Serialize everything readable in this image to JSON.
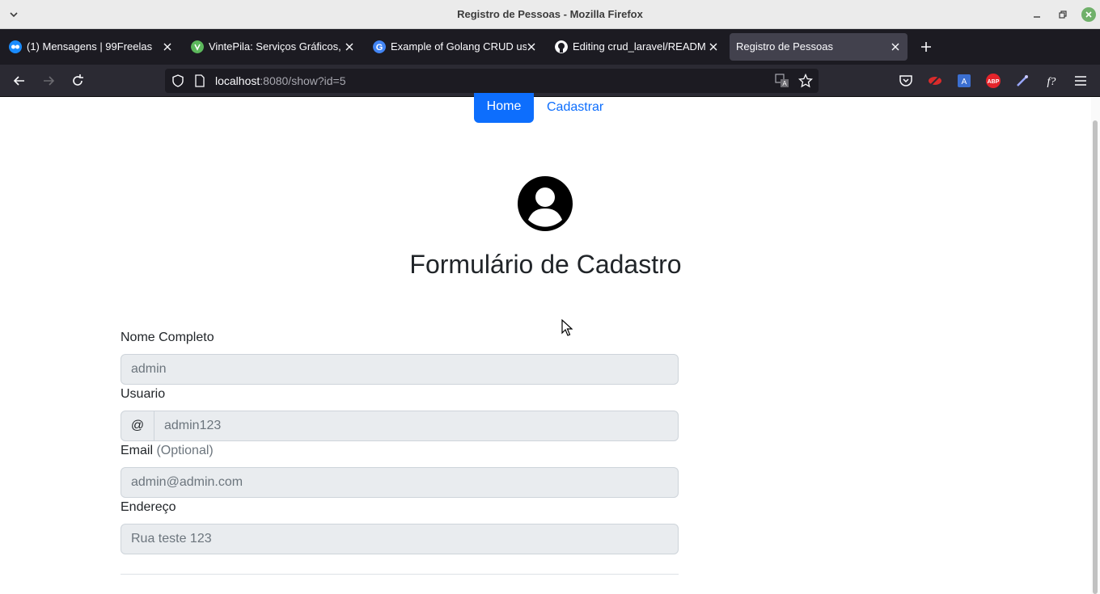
{
  "window": {
    "title": "Registro de Pessoas - Mozilla Firefox"
  },
  "tabs": [
    {
      "label": "(1) Mensagens | 99Freelas",
      "icon": "99freelas-icon",
      "active": false
    },
    {
      "label": "VintePila: Serviços Gráficos, ",
      "icon": "vintepila-icon",
      "active": false
    },
    {
      "label": "Example of Golang CRUD us",
      "icon": "google-icon",
      "active": false
    },
    {
      "label": "Editing crud_laravel/READM",
      "icon": "github-icon",
      "active": false
    },
    {
      "label": "Registro de Pessoas",
      "icon": "",
      "active": true
    }
  ],
  "urlbar": {
    "host": "localhost",
    "path": ":8080/show?id=5"
  },
  "nav": {
    "home": "Home",
    "register": "Cadastrar"
  },
  "form": {
    "heading": "Formulário de Cadastro",
    "name_label": "Nome Completo",
    "name_value": "admin",
    "user_label": "Usuario",
    "user_prefix": "@",
    "user_value": "admin123",
    "email_label": "Email",
    "email_optional": "(Optional)",
    "email_value": "admin@admin.com",
    "address_label": "Endereço",
    "address_value": "Rua teste 123"
  },
  "colors": {
    "primary": "#0d6efd",
    "tabbar": "#1c1b22",
    "toolbar": "#2b2a33"
  }
}
